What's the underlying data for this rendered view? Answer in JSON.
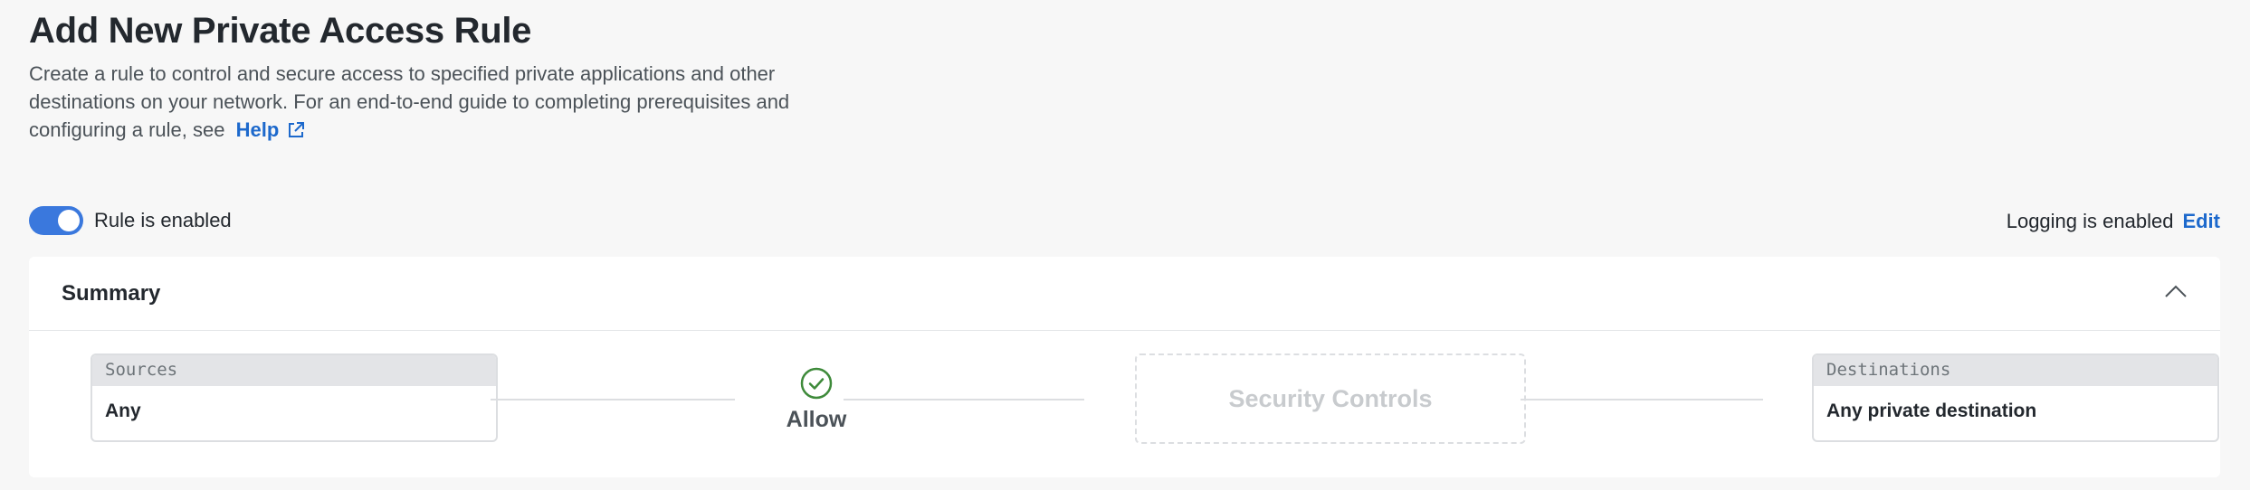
{
  "page": {
    "title": "Add New Private Access Rule",
    "description_text": "Create a rule to control and secure access to specified private applications and other destinations on your network. For an end-to-end guide to completing prerequisites and configuring a rule, see",
    "help_link": "Help",
    "help_icon": "external-link-icon"
  },
  "rule_toggle": {
    "label": "Rule is enabled",
    "enabled": true,
    "accent": "#3a78dd"
  },
  "logging": {
    "text": "Logging is enabled",
    "edit_label": "Edit"
  },
  "summary": {
    "title": "Summary",
    "collapse_icon": "chevron-up-icon",
    "sources": {
      "label": "Sources",
      "value": "Any"
    },
    "action": {
      "label": "Allow",
      "icon": "check-circle-icon",
      "color": "#3e8a3a"
    },
    "security_controls": {
      "label": "Security Controls"
    },
    "destinations": {
      "label": "Destinations",
      "value": "Any private destination"
    }
  }
}
